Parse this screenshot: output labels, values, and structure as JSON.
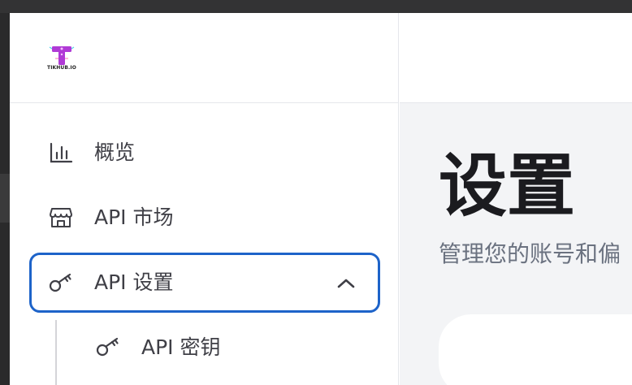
{
  "logo": {
    "text": "TIKHUB.IO"
  },
  "sidebar": {
    "items": [
      {
        "label": "概览",
        "icon": "bar-chart-icon"
      },
      {
        "label": "API 市场",
        "icon": "storefront-icon"
      },
      {
        "label": "API 设置",
        "icon": "key-icon",
        "expanded": true,
        "active": true
      },
      {
        "label": "API 密钥",
        "icon": "key-icon",
        "sub": true
      }
    ]
  },
  "main": {
    "title": "设置",
    "subtitle": "管理您的账号和偏"
  },
  "colors": {
    "active_border": "#1d63c9",
    "text": "#3f3f46",
    "content_bg": "#f3f4f6"
  }
}
